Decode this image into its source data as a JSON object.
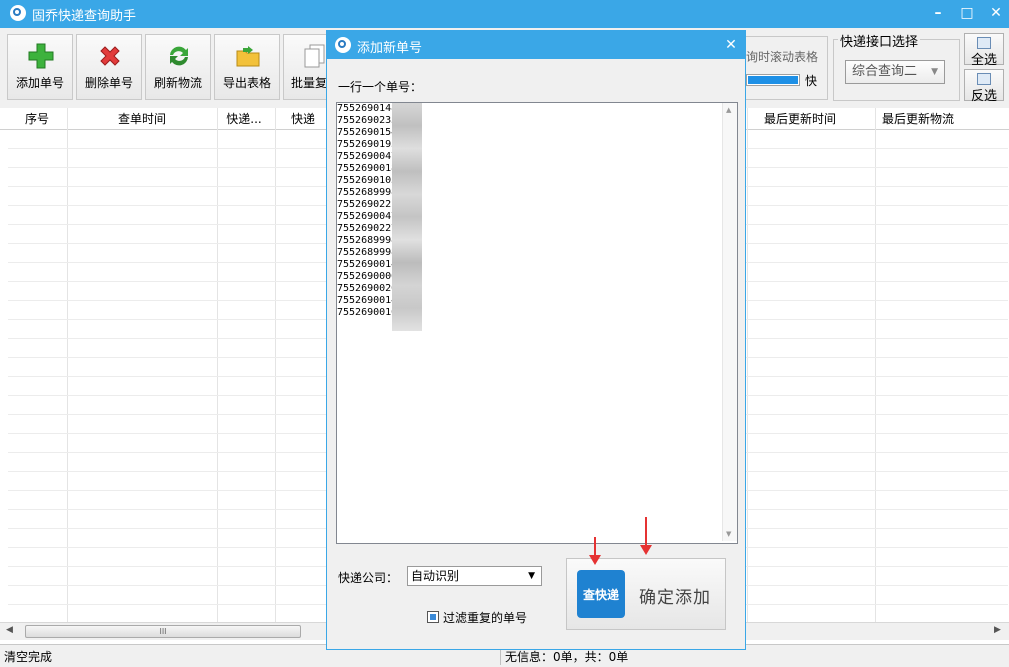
{
  "window": {
    "title": "固乔快递查询助手"
  },
  "toolbar": {
    "buttons": [
      {
        "label": "添加单号",
        "icon": "plus-icon"
      },
      {
        "label": "删除单号",
        "icon": "delete-x-icon"
      },
      {
        "label": "刷新物流",
        "icon": "refresh-icon"
      },
      {
        "label": "导出表格",
        "icon": "folder-export-icon"
      },
      {
        "label": "批量复"
      }
    ],
    "scroll_table_label": "询时滚动表格",
    "speed_label": "快",
    "api_group_title": "快递接口选择",
    "api_selected": "综合查询二",
    "select_all": "全选",
    "invert_select": "反选"
  },
  "grid": {
    "columns": [
      "序号",
      "查单时间",
      "快递...",
      "快递",
      "最后更新时间",
      "最后更新物流"
    ]
  },
  "scrollbar": {
    "thumb_glyph": "III"
  },
  "status": {
    "left": "清空完成",
    "right": "无信息：0单，共：0单"
  },
  "dialog": {
    "title": "添加新单号",
    "prompt": "一行一个单号：",
    "numbers": [
      "7552690148",
      "7552690233",
      "7552690154",
      "7552690193",
      "7552690047",
      "7552690018",
      "7552690105",
      "7552689998",
      "7552690221",
      "7552690047",
      "7552690227",
      "7552689998",
      "7552689998",
      "7552690014",
      "7552690006",
      "7552690026",
      "7552690014",
      "7552690010"
    ],
    "company_label": "快递公司：",
    "company_value": "自动识别",
    "filter_label": "过滤重复的单号",
    "filter_checked": true,
    "confirm_label": "确定添加",
    "confirm_logo": "查快递"
  },
  "colors": {
    "title_bar": "#3aa7e7",
    "annotation_arrow": "#e53232",
    "logo_blue": "#1f82d1"
  }
}
